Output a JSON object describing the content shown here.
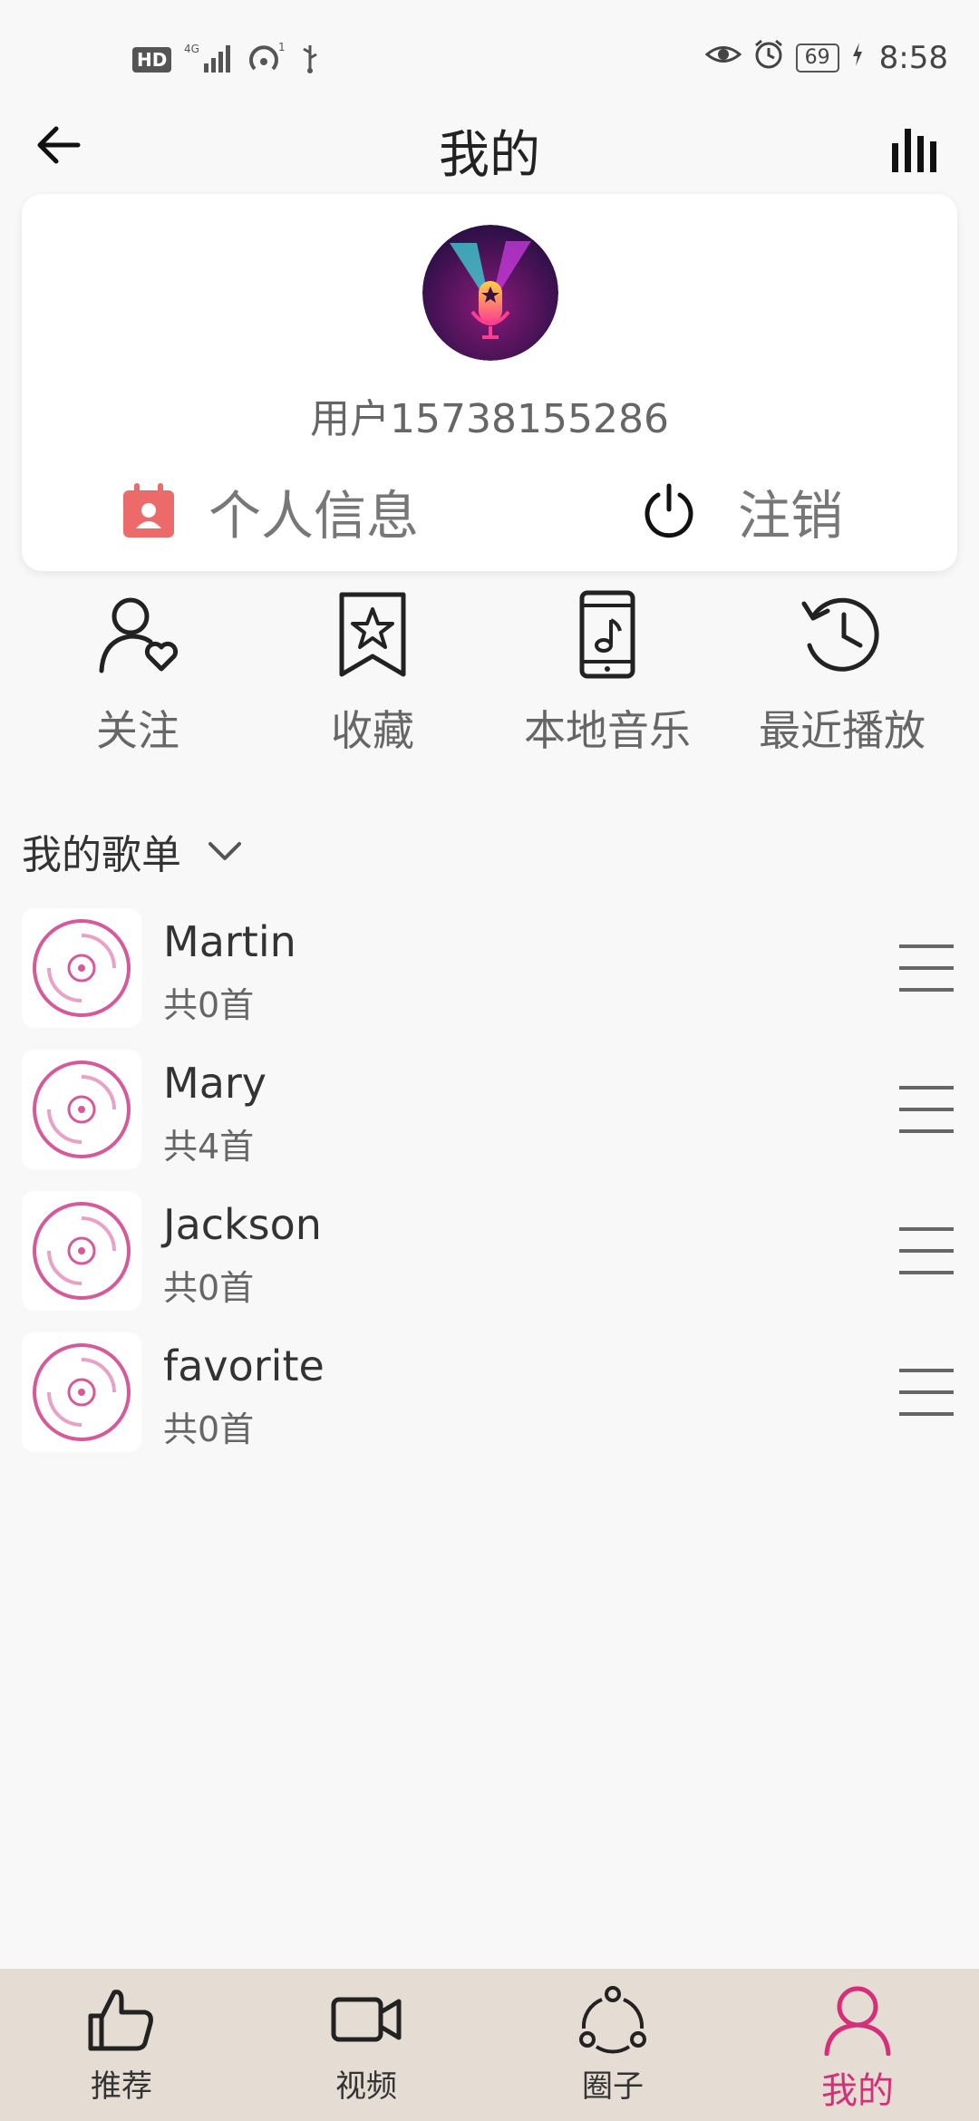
{
  "status_bar": {
    "hd": "HD",
    "signal": "4G",
    "sim_index": "1",
    "battery": "69",
    "time": "8:58"
  },
  "header": {
    "title": "我的",
    "back_icon": "arrow-left-icon",
    "menu_icon": "equalizer-icon"
  },
  "profile": {
    "username": "用户15738155286",
    "info_label": "个人信息",
    "logout_label": "注销"
  },
  "quick_actions": [
    {
      "label": "关注",
      "icon": "user-heart-icon"
    },
    {
      "label": "收藏",
      "icon": "bookmark-star-icon"
    },
    {
      "label": "本地音乐",
      "icon": "phone-music-icon"
    },
    {
      "label": "最近播放",
      "icon": "history-icon"
    }
  ],
  "playlists_section": {
    "title": "我的歌单",
    "items": [
      {
        "name": "Martin",
        "count": "共0首"
      },
      {
        "name": "Mary",
        "count": "共4首"
      },
      {
        "name": "Jackson",
        "count": "共0首"
      },
      {
        "name": "favorite",
        "count": "共0首"
      }
    ]
  },
  "bottom_nav": {
    "items": [
      {
        "label": "推荐",
        "icon": "thumbs-up-icon"
      },
      {
        "label": "视频",
        "icon": "video-camera-icon"
      },
      {
        "label": "圈子",
        "icon": "share-circle-icon"
      },
      {
        "label": "我的",
        "icon": "user-icon"
      }
    ],
    "active": "我的",
    "active_color": "#d62f7a"
  },
  "colors": {
    "accent": "#d62f7a",
    "playlist_disc": "#d65a9a",
    "info_icon": "#ec6a6a",
    "nav_bg": "#e5dcd3"
  }
}
